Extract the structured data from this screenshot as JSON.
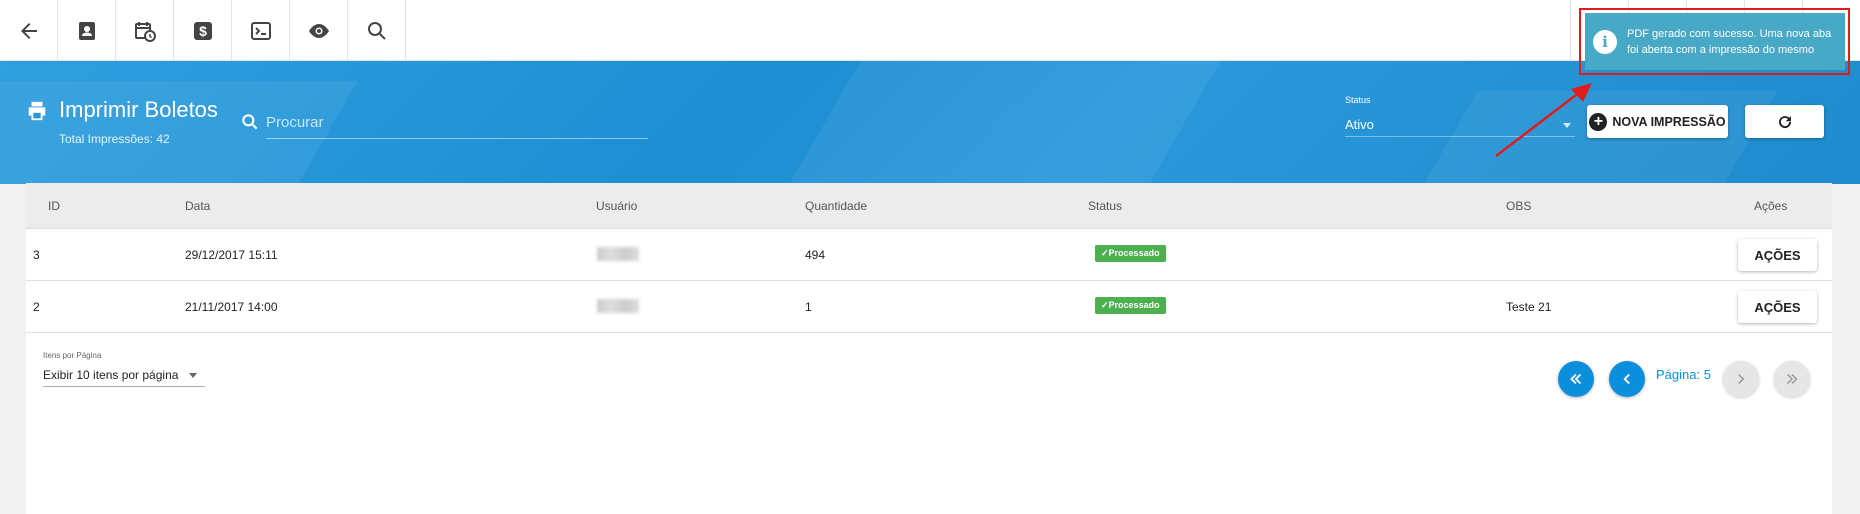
{
  "toolbar": {
    "left_icons": [
      "back-arrow-icon",
      "contact-card-icon",
      "calendar-clock-icon",
      "dollar-icon",
      "terminal-icon",
      "eye-icon",
      "search-icon"
    ],
    "right_icons": [
      "file-icon",
      "chart-icon",
      "home-icon",
      "user-icon",
      "menu-icon"
    ]
  },
  "header": {
    "title": "Imprimir Boletos",
    "subtitle": "Total Impressões: 42",
    "search_placeholder": "Procurar",
    "status_label": "Status",
    "status_value": "Ativo",
    "new_button_label": "NOVA IMPRESSÃO"
  },
  "toast": {
    "line1": "PDF gerado com sucesso. Uma nova aba",
    "line2": "foi aberta com a impressão do mesmo"
  },
  "table": {
    "columns": [
      "ID",
      "Data",
      "Usuário",
      "Quantidade",
      "Status",
      "OBS",
      "Ações"
    ],
    "rows": [
      {
        "id": "3",
        "data": "29/12/2017 15:11",
        "usuario": "",
        "quantidade": "494",
        "status": "Processado",
        "obs": "",
        "acoes": "AÇÕES"
      },
      {
        "id": "2",
        "data": "21/11/2017 14:00",
        "usuario": "",
        "quantidade": "1",
        "status": "Processado",
        "obs": "Teste 21",
        "acoes": "AÇÕES"
      }
    ]
  },
  "pagination": {
    "per_page_label": "Itens por Página",
    "per_page_value": "Exibir 10 itens por página",
    "page_label": "Página: 5"
  },
  "colors": {
    "header_blue": "#2a96d8",
    "accent": "#0b8fdc",
    "success": "#4caf50",
    "toast": "#48a9c7",
    "highlight": "#e01b1b"
  }
}
